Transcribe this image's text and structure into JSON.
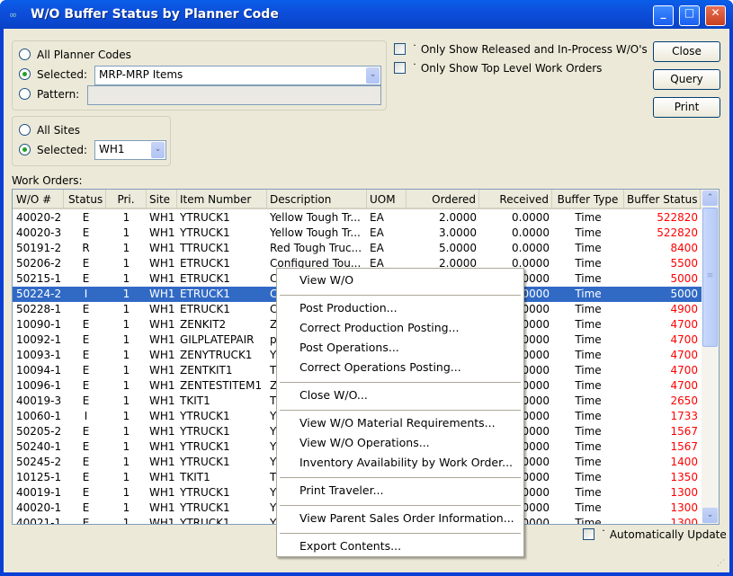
{
  "window": {
    "title": "W/O Buffer Status by Planner Code"
  },
  "planner": {
    "all_label": "All Planner Codes",
    "selected_label": "Selected:",
    "selected_value": "MRP-MRP Items",
    "pattern_label": "Pattern:",
    "pattern_value": "",
    "mode": "selected"
  },
  "sites": {
    "all_label": "All Sites",
    "selected_label": "Selected:",
    "selected_value": "WH1",
    "mode": "selected"
  },
  "options": {
    "released_label": "Only Show Released and In-Process W/O's",
    "released_checked": false,
    "toplevel_label": "Only Show Top Level Work Orders",
    "toplevel_checked": false
  },
  "buttons": {
    "close": "Close",
    "query": "Query",
    "print": "Print"
  },
  "work_orders": {
    "label": "Work Orders:",
    "columns": [
      "W/O #",
      "Status",
      "Pri.",
      "Site",
      "Item Number",
      "Description",
      "UOM",
      "Ordered",
      "Received",
      "Buffer Type",
      "Buffer Status"
    ],
    "rows": [
      [
        "40020-2",
        "E",
        "1",
        "WH1",
        "YTRUCK1",
        "Yellow Tough Tr...",
        "EA",
        "2.0000",
        "0.0000",
        "Time",
        "522820"
      ],
      [
        "40020-3",
        "E",
        "1",
        "WH1",
        "YTRUCK1",
        "Yellow Tough Tr...",
        "EA",
        "3.0000",
        "0.0000",
        "Time",
        "522820"
      ],
      [
        "50191-2",
        "R",
        "1",
        "WH1",
        "TTRUCK1",
        "Red Tough Truc...",
        "EA",
        "5.0000",
        "0.0000",
        "Time",
        "8400"
      ],
      [
        "50206-2",
        "E",
        "1",
        "WH1",
        "ETRUCK1",
        "Configured Tou...",
        "EA",
        "2.0000",
        "0.0000",
        "Time",
        "5500"
      ],
      [
        "50215-1",
        "E",
        "1",
        "WH1",
        "ETRUCK1",
        "C",
        "",
        "",
        "0.0000",
        "Time",
        "5000"
      ],
      [
        "50224-2",
        "I",
        "1",
        "WH1",
        "ETRUCK1",
        "C",
        "",
        "",
        "0.0000",
        "Time",
        "5000"
      ],
      [
        "50228-1",
        "E",
        "1",
        "WH1",
        "ETRUCK1",
        "C",
        "",
        "",
        "0.0000",
        "Time",
        "4900"
      ],
      [
        "10090-1",
        "E",
        "1",
        "WH1",
        "ZENKIT2",
        "Z",
        "",
        "",
        "0.0000",
        "Time",
        "4700"
      ],
      [
        "10092-1",
        "E",
        "1",
        "WH1",
        "GILPLATEPAIR",
        "p",
        "",
        "",
        "0.0000",
        "Time",
        "4700"
      ],
      [
        "10093-1",
        "E",
        "1",
        "WH1",
        "ZENYTRUCK1",
        "Y",
        "",
        "",
        "0.0000",
        "Time",
        "4700"
      ],
      [
        "10094-1",
        "E",
        "1",
        "WH1",
        "ZENTKIT1",
        "T",
        "",
        "",
        "0.0000",
        "Time",
        "4700"
      ],
      [
        "10096-1",
        "E",
        "1",
        "WH1",
        "ZENTESTITEM1",
        "Z",
        "",
        "",
        "0.0000",
        "Time",
        "4700"
      ],
      [
        "40019-3",
        "E",
        "1",
        "WH1",
        "TKIT1",
        "T",
        "",
        "",
        "0.0000",
        "Time",
        "2650"
      ],
      [
        "10060-1",
        "I",
        "1",
        "WH1",
        "YTRUCK1",
        "Y",
        "",
        "",
        "0.0000",
        "Time",
        "1733"
      ],
      [
        "50205-2",
        "E",
        "1",
        "WH1",
        "YTRUCK1",
        "Y",
        "",
        "",
        "0.0000",
        "Time",
        "1567"
      ],
      [
        "50240-1",
        "E",
        "1",
        "WH1",
        "YTRUCK1",
        "Y",
        "",
        "",
        "0.0000",
        "Time",
        "1567"
      ],
      [
        "50245-2",
        "E",
        "1",
        "WH1",
        "YTRUCK1",
        "Y",
        "",
        "",
        "0.0000",
        "Time",
        "1400"
      ],
      [
        "10125-1",
        "E",
        "1",
        "WH1",
        "TKIT1",
        "T",
        "",
        "",
        "0.0000",
        "Time",
        "1350"
      ],
      [
        "40019-1",
        "E",
        "1",
        "WH1",
        "YTRUCK1",
        "Y",
        "",
        "",
        "0.0000",
        "Time",
        "1300"
      ],
      [
        "40020-1",
        "E",
        "1",
        "WH1",
        "YTRUCK1",
        "Y",
        "",
        "",
        "0.0000",
        "Time",
        "1300"
      ],
      [
        "40021-1",
        "E",
        "1",
        "WH1",
        "YTRUCK1",
        "Y",
        "",
        "",
        "0.0000",
        "Time",
        "1300"
      ]
    ],
    "selected_row": "50224-2"
  },
  "context_menu": [
    {
      "label": "View W/O"
    },
    {
      "sep": true
    },
    {
      "label": "Post Production..."
    },
    {
      "label": "Correct Production Posting..."
    },
    {
      "label": "Post Operations..."
    },
    {
      "label": "Correct Operations Posting..."
    },
    {
      "sep": true
    },
    {
      "label": "Close W/O..."
    },
    {
      "sep": true
    },
    {
      "label": "View W/O Material Requirements..."
    },
    {
      "label": "View W/O Operations..."
    },
    {
      "label": "Inventory Availability by Work Order..."
    },
    {
      "sep": true
    },
    {
      "label": "Print Traveler..."
    },
    {
      "sep": true
    },
    {
      "label": "View Parent Sales Order Information..."
    },
    {
      "sep": true
    },
    {
      "label": "Export Contents..."
    }
  ],
  "auto_update": {
    "label": "Automatically Update",
    "checked": false
  },
  "colors": {
    "titlebar": "#0a5ee8",
    "selection": "#316ac5",
    "buffer_status": "#ff0000"
  }
}
